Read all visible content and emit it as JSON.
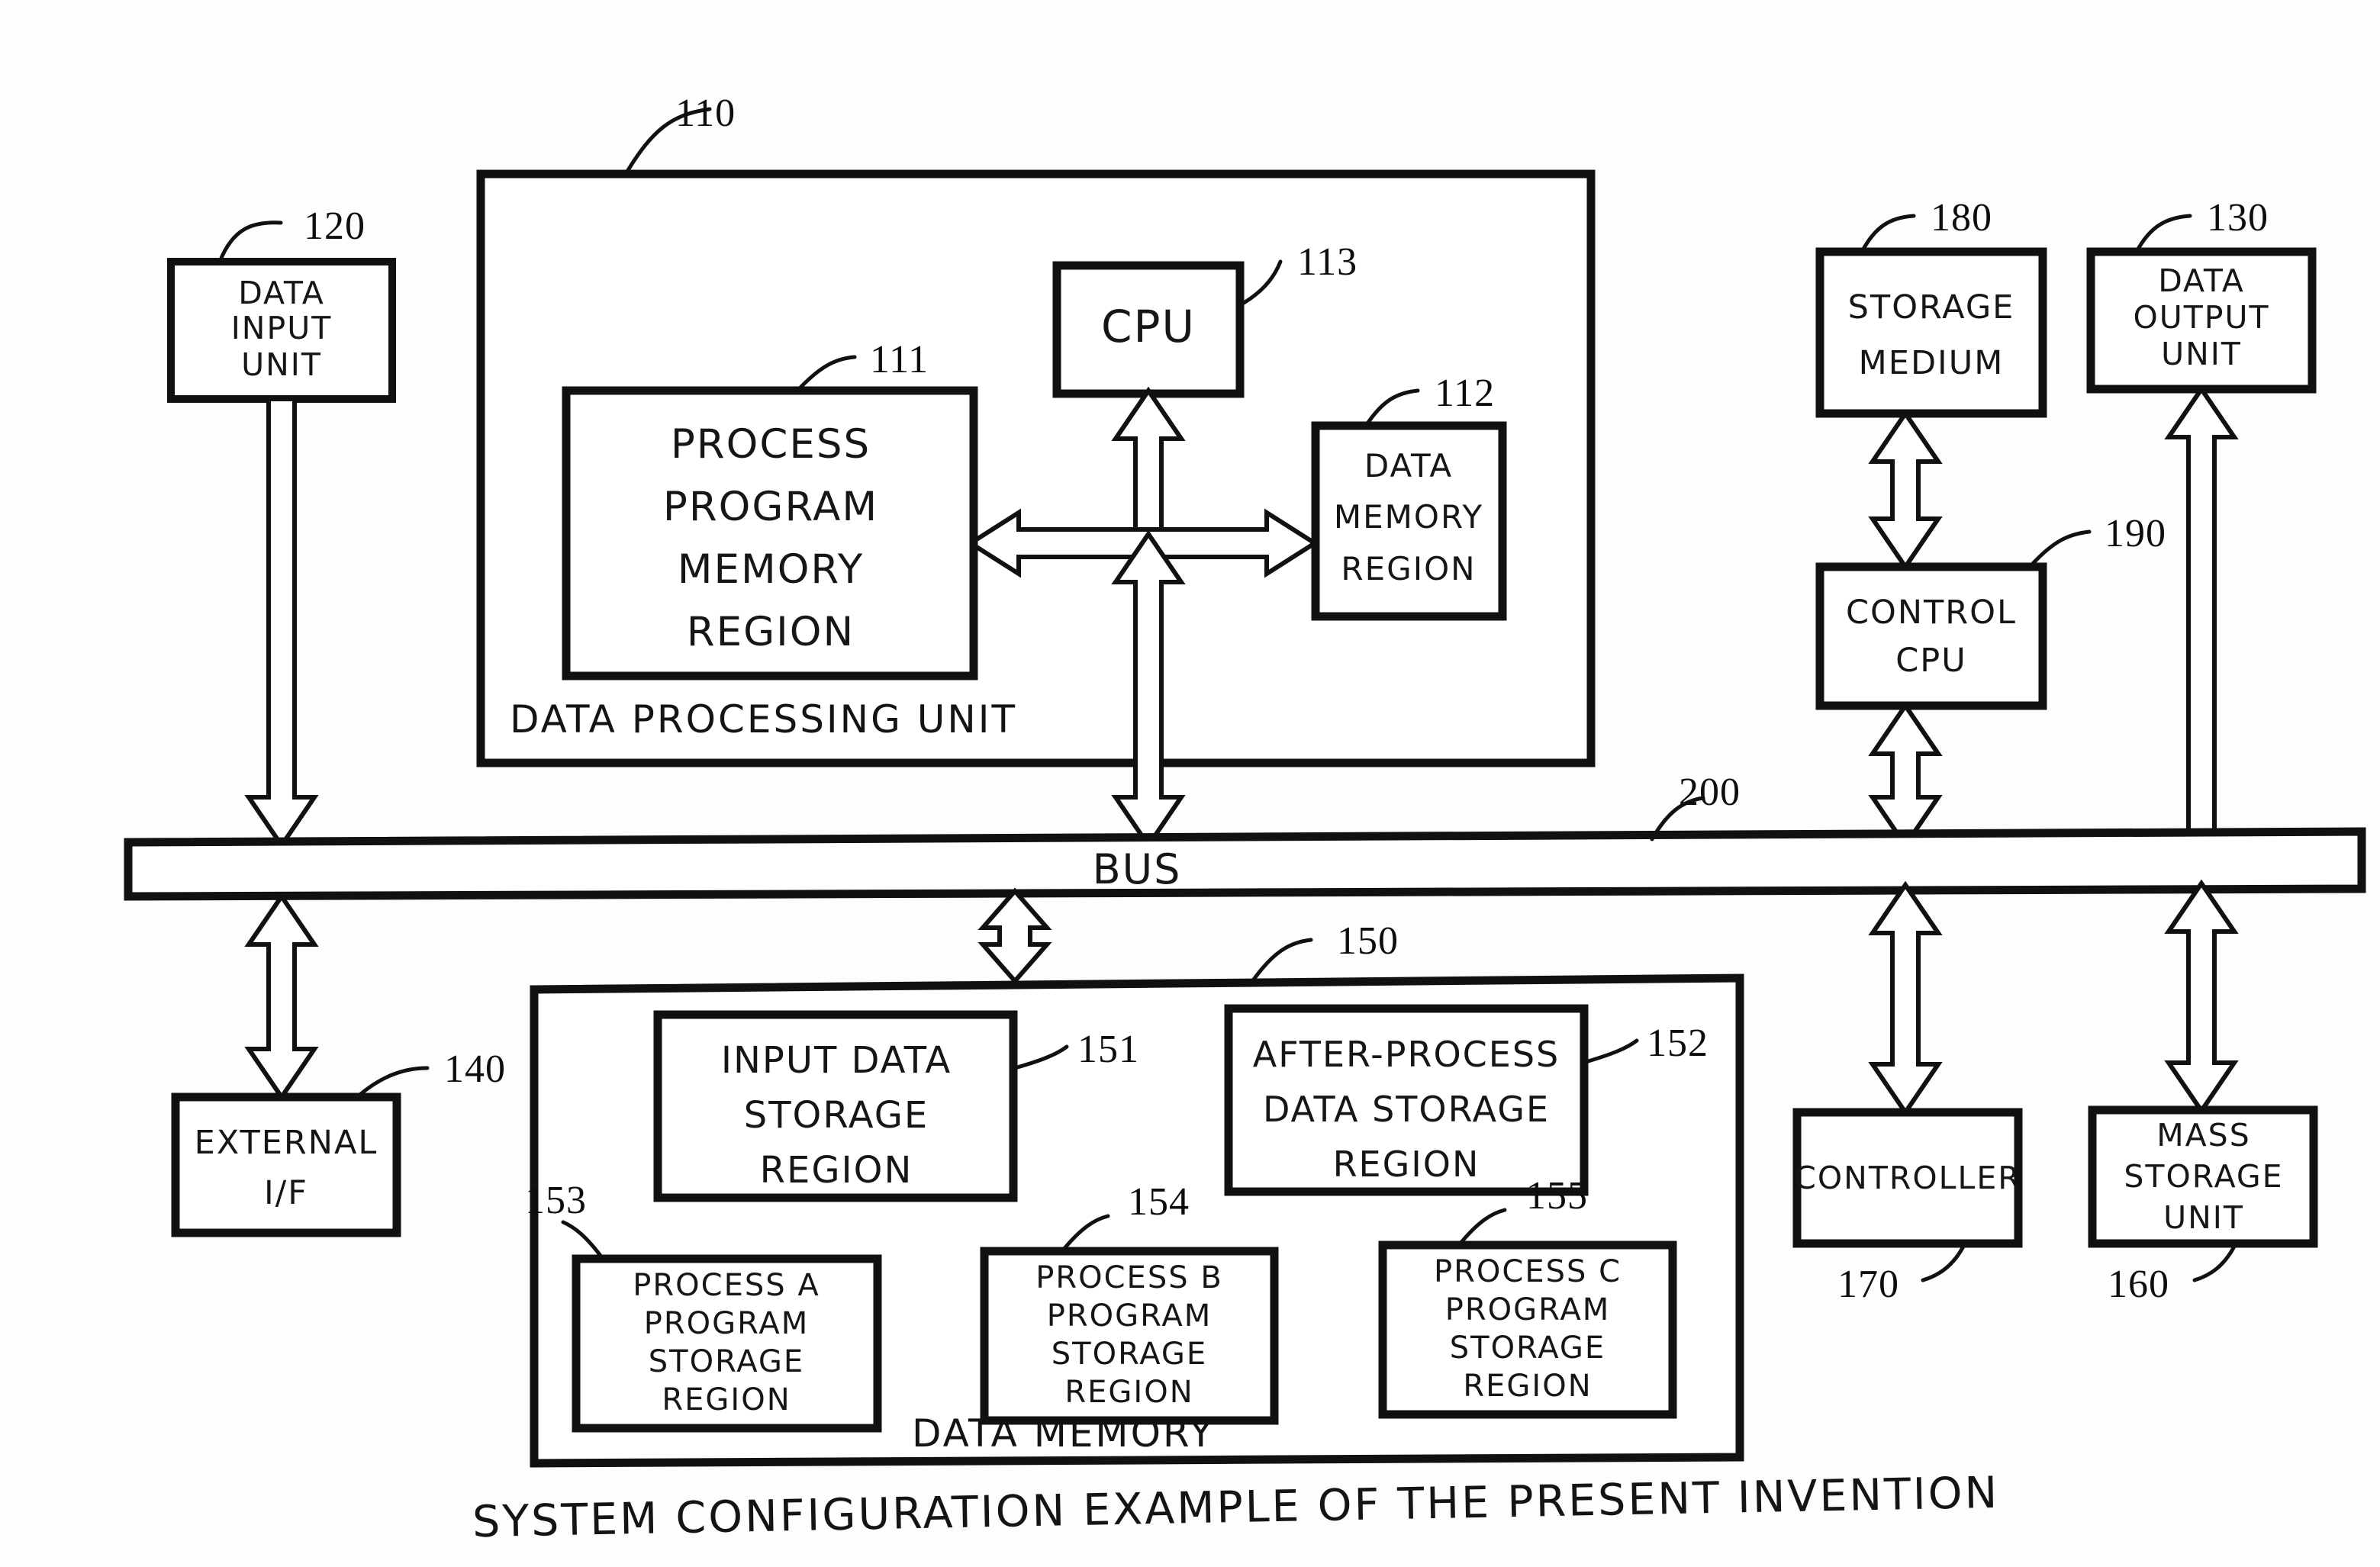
{
  "figure": {
    "caption": "SYSTEM CONFIGURATION EXAMPLE OF THE PRESENT INVENTION",
    "style": "hand-drawn patent block diagram",
    "ink_color": "#111111",
    "paper_color": "#fdfdfd"
  },
  "blocks": {
    "data_input_unit": {
      "ref": "120",
      "lines": [
        "DATA",
        "INPUT",
        "UNIT"
      ]
    },
    "data_processing_unit": {
      "ref": "110",
      "label": "DATA PROCESSING UNIT"
    },
    "process_program_memory_region": {
      "ref": "111",
      "lines": [
        "PROCESS",
        "PROGRAM",
        "MEMORY",
        "REGION"
      ]
    },
    "data_memory_region": {
      "ref": "112",
      "lines": [
        "DATA",
        "MEMORY",
        "REGION"
      ]
    },
    "cpu": {
      "ref": "113",
      "lines": [
        "CPU"
      ]
    },
    "data_output_unit": {
      "ref": "130",
      "lines": [
        "DATA",
        "OUTPUT",
        "UNIT"
      ]
    },
    "external_if": {
      "ref": "140",
      "lines": [
        "EXTERNAL",
        "I/F"
      ]
    },
    "data_memory": {
      "ref": "150",
      "label": "DATA MEMORY"
    },
    "input_data_storage_region": {
      "ref": "151",
      "lines": [
        "INPUT DATA",
        "STORAGE",
        "REGION"
      ]
    },
    "after_process_data_storage_region": {
      "ref": "152",
      "lines": [
        "AFTER-PROCESS",
        "DATA STORAGE",
        "REGION"
      ]
    },
    "process_a_program_storage_region": {
      "ref": "153",
      "lines": [
        "PROCESS  A",
        "PROGRAM",
        "STORAGE",
        "REGION"
      ]
    },
    "process_b_program_storage_region": {
      "ref": "154",
      "lines": [
        "PROCESS B",
        "PROGRAM",
        "STORAGE",
        "REGION"
      ]
    },
    "process_c_program_storage_region": {
      "ref": "155",
      "lines": [
        "PROCESS C",
        "PROGRAM",
        "STORAGE",
        "REGION"
      ]
    },
    "mass_storage_unit": {
      "ref": "160",
      "lines": [
        "MASS",
        "STORAGE",
        "UNIT"
      ]
    },
    "controller": {
      "ref": "170",
      "lines": [
        "CONTROLLER"
      ]
    },
    "storage_medium": {
      "ref": "180",
      "lines": [
        "STORAGE",
        "MEDIUM"
      ]
    },
    "control_cpu": {
      "ref": "190",
      "lines": [
        "CONTROL",
        "CPU"
      ]
    },
    "bus": {
      "ref": "200",
      "label": "BUS"
    }
  },
  "connections": [
    {
      "from": "data_input_unit",
      "to": "bus",
      "kind": "single-down"
    },
    {
      "from": "bus",
      "to": "external_if",
      "kind": "double-vertical"
    },
    {
      "from": "data_processing_unit",
      "to": "bus",
      "kind": "double-vertical"
    },
    {
      "from": "bus",
      "to": "data_memory",
      "kind": "double-vertical"
    },
    {
      "from": "cpu",
      "to": "internal_bus",
      "kind": "double-vertical"
    },
    {
      "from": "process_program_memory_region",
      "to": "data_memory_region",
      "kind": "double-horizontal"
    },
    {
      "from": "storage_medium",
      "to": "control_cpu",
      "kind": "double-vertical"
    },
    {
      "from": "control_cpu",
      "to": "bus",
      "kind": "double-vertical"
    },
    {
      "from": "bus",
      "to": "data_output_unit",
      "kind": "single-up"
    },
    {
      "from": "bus",
      "to": "controller",
      "kind": "double-vertical"
    },
    {
      "from": "bus",
      "to": "mass_storage_unit",
      "kind": "double-vertical"
    }
  ]
}
